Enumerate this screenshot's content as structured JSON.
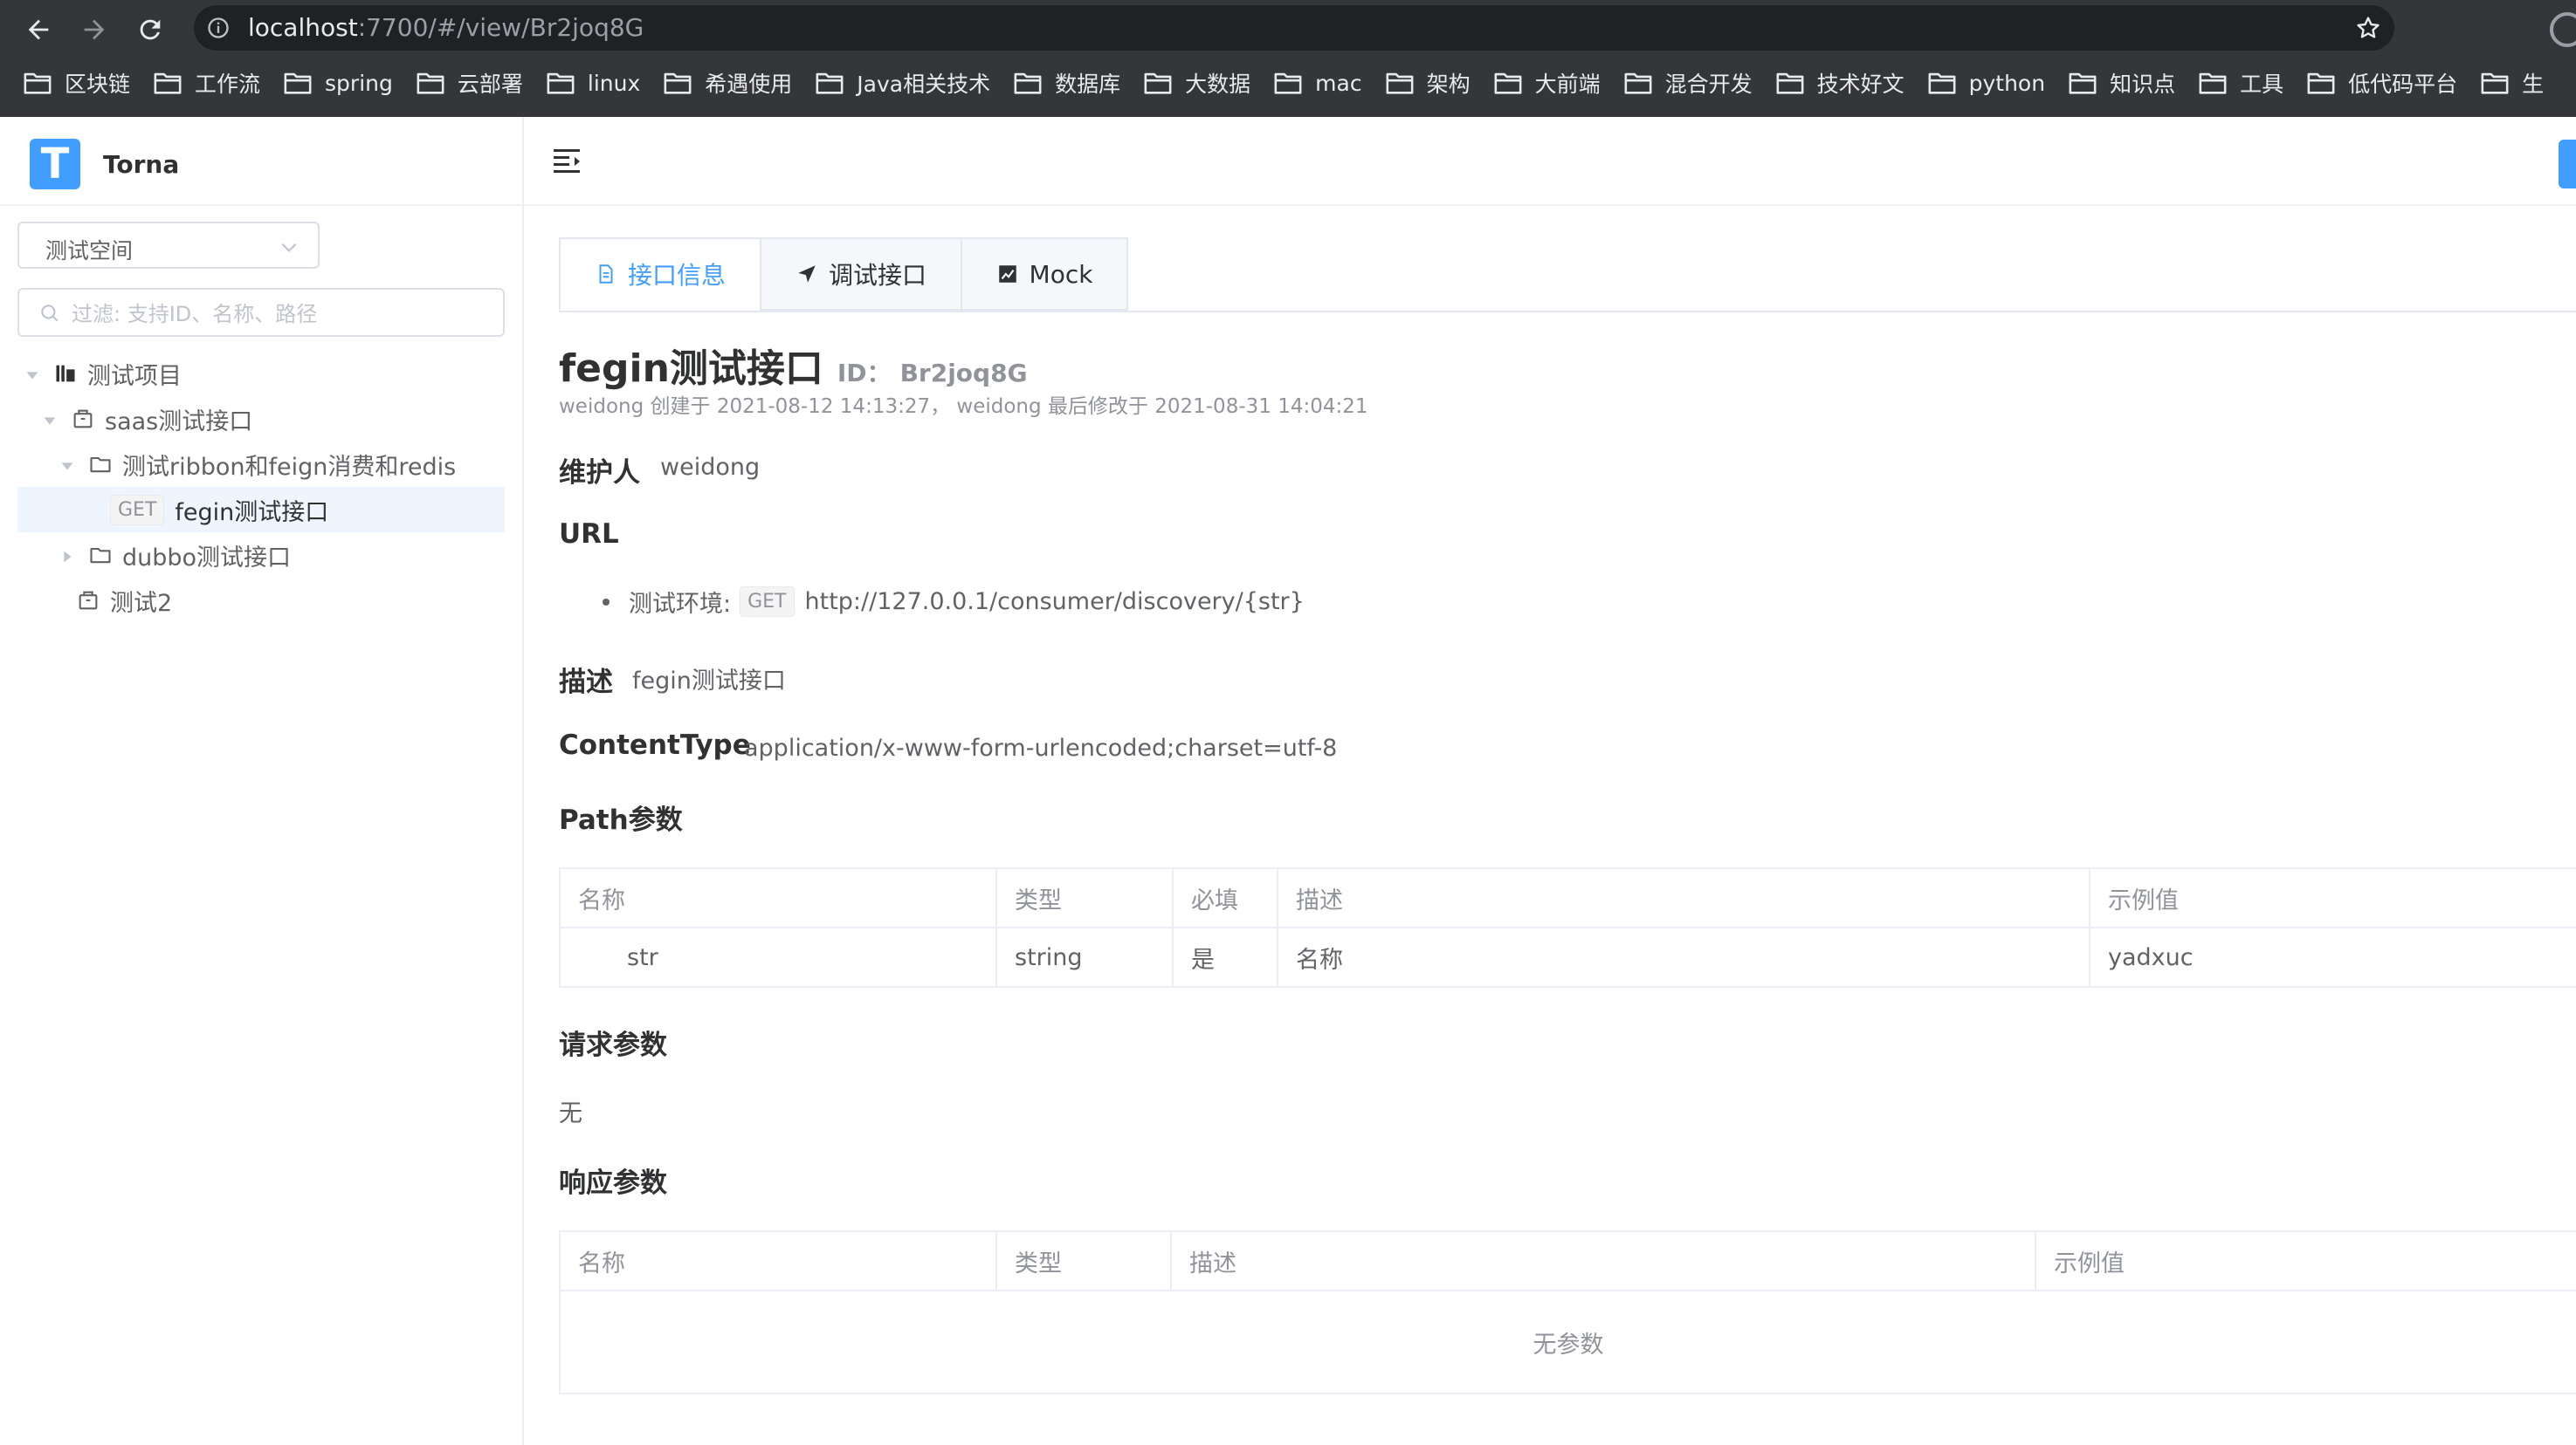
{
  "browser": {
    "url_host": "localhost",
    "url_rest": ":7700/#/view/Br2joq8G",
    "bookmarks": [
      "区块链",
      "工作流",
      "spring",
      "云部署",
      "linux",
      "希遇使用",
      "Java相关技术",
      "数据库",
      "大数据",
      "mac",
      "架构",
      "大前端",
      "混合开发",
      "技术好文",
      "python",
      "知识点",
      "工具",
      "低代码平台",
      "生"
    ]
  },
  "app": {
    "brand": "Torna",
    "logo_letter": "T",
    "accent": "#409eff",
    "space": "测试空间",
    "filter_placeholder": "过滤: 支持ID、名称、路径"
  },
  "tree": [
    {
      "label": "测试项目",
      "icon": "project-icon",
      "expanded": true
    },
    {
      "label": "saas测试接口",
      "icon": "module-icon",
      "expanded": true
    },
    {
      "label": "测试ribbon和feign消费和redis",
      "icon": "folder-icon",
      "expanded": true
    },
    {
      "method": "GET",
      "label": "fegin测试接口",
      "active": true
    },
    {
      "label": "dubbo测试接口",
      "icon": "folder-icon",
      "expanded": false
    },
    {
      "label": "测试2",
      "icon": "module-icon"
    }
  ],
  "tabs": [
    "接口信息",
    "调试接口",
    "Mock"
  ],
  "doc": {
    "title": "fegin测试接口",
    "id_label": "ID：",
    "id": "Br2joq8G",
    "meta": "weidong 创建于 2021-08-12 14:13:27， weidong 最后修改于 2021-08-31 14:04:21",
    "maintainer_label": "维护人",
    "maintainer": "weidong",
    "url_label": "URL",
    "env_label": "测试环境:",
    "method": "GET",
    "url": "http://127.0.0.1/consumer/discovery/{str}",
    "desc_label": "描述",
    "desc": "fegin测试接口",
    "content_type_label": "ContentType",
    "content_type": "application/x-www-form-urlencoded;charset=utf-8",
    "path_params_label": "Path参数",
    "path_params_headers": [
      "名称",
      "类型",
      "必填",
      "描述",
      "示例值"
    ],
    "path_params_rows": [
      {
        "name": "str",
        "type": "string",
        "required": "是",
        "desc": "名称",
        "example": "yadxuc"
      }
    ],
    "req_params_label": "请求参数",
    "req_params_none": "无",
    "resp_params_label": "响应参数",
    "resp_params_headers": [
      "名称",
      "类型",
      "描述",
      "示例值"
    ],
    "resp_params_empty": "无参数"
  }
}
